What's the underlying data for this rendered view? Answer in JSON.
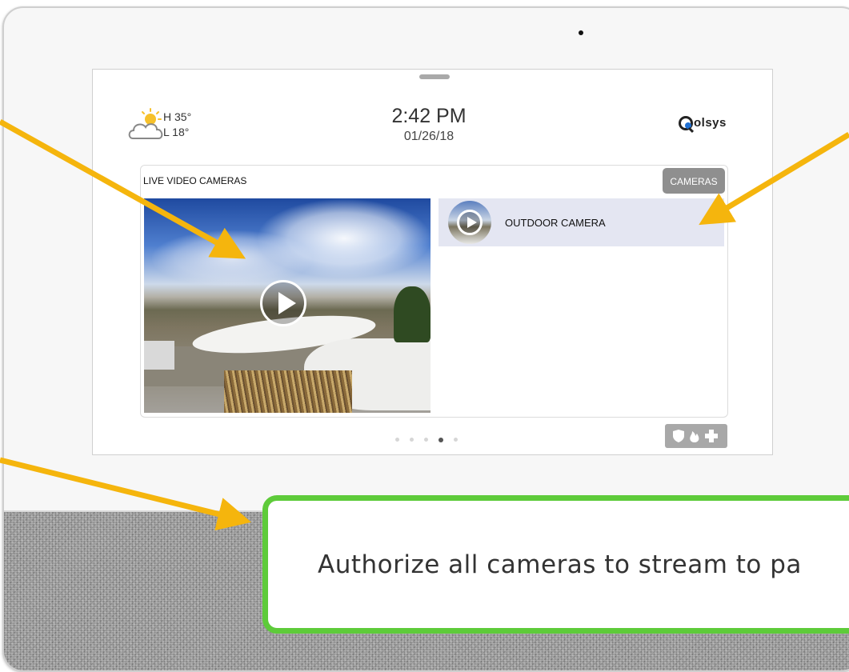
{
  "weather": {
    "high": "H 35°",
    "low": "L 18°",
    "icon": "partly-cloudy-icon"
  },
  "clock": {
    "time": "2:42 PM",
    "date": "01/26/18"
  },
  "brand": {
    "name": "olsys"
  },
  "camera_panel": {
    "title": "LIVE VIDEO CAMERAS",
    "cameras_button": "CAMERAS",
    "cameras": [
      {
        "name": "OUTDOOR CAMERA"
      }
    ]
  },
  "pagination": {
    "count": 5,
    "active_index": 3
  },
  "callout": {
    "text": "Authorize all cameras to stream to pa"
  },
  "colors": {
    "arrow": "#f5b50d",
    "callout_border": "#5ecb3a",
    "cameras_button": "#8f8f8f",
    "selected_row": "#e4e6f2"
  }
}
